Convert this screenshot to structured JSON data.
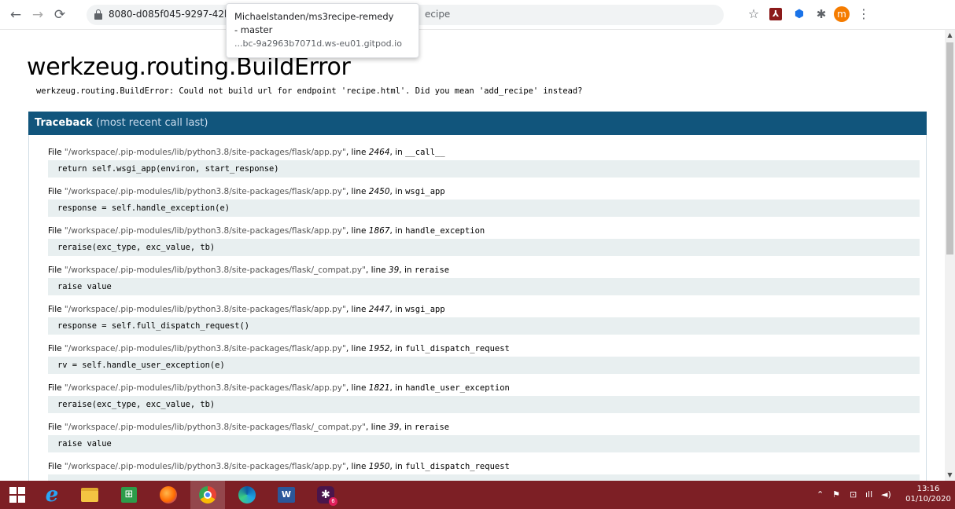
{
  "browser": {
    "url_visible_start": "8080-d085f045-9297-42bc-94b",
    "url_visible_end": "ecipe",
    "profile_initial": "m",
    "tooltip": {
      "title_line1": "Michaelstanden/ms3recipe-remedy",
      "title_line2": "- master",
      "url": "...bc-9a2963b7071d.ws-eu01.gitpod.io"
    },
    "icons": [
      "back-arrow-icon",
      "forward-arrow-icon",
      "reload-icon",
      "lock-icon",
      "star-icon",
      "acrobat-icon",
      "extension-icon",
      "puzzle-icon",
      "profile-avatar",
      "menu-dots-icon"
    ]
  },
  "page": {
    "title": "werkzeug.routing.BuildError",
    "error_message": "werkzeug.routing.BuildError: Could not build url for endpoint 'recipe.html'. Did you mean 'add_recipe' instead?",
    "traceback_header": "Traceback",
    "traceback_sub": "(most recent call last)",
    "frames": [
      {
        "file": "\"/workspace/.pip-modules/lib/python3.8/site-packages/flask/app.py\"",
        "line": "2464",
        "func": "__call__",
        "source": "return self.wsgi_app(environ, start_response)"
      },
      {
        "file": "\"/workspace/.pip-modules/lib/python3.8/site-packages/flask/app.py\"",
        "line": "2450",
        "func": "wsgi_app",
        "source": "response = self.handle_exception(e)"
      },
      {
        "file": "\"/workspace/.pip-modules/lib/python3.8/site-packages/flask/app.py\"",
        "line": "1867",
        "func": "handle_exception",
        "source": "reraise(exc_type, exc_value, tb)"
      },
      {
        "file": "\"/workspace/.pip-modules/lib/python3.8/site-packages/flask/_compat.py\"",
        "line": "39",
        "func": "reraise",
        "source": "raise value"
      },
      {
        "file": "\"/workspace/.pip-modules/lib/python3.8/site-packages/flask/app.py\"",
        "line": "2447",
        "func": "wsgi_app",
        "source": "response = self.full_dispatch_request()"
      },
      {
        "file": "\"/workspace/.pip-modules/lib/python3.8/site-packages/flask/app.py\"",
        "line": "1952",
        "func": "full_dispatch_request",
        "source": "rv = self.handle_user_exception(e)"
      },
      {
        "file": "\"/workspace/.pip-modules/lib/python3.8/site-packages/flask/app.py\"",
        "line": "1821",
        "func": "handle_user_exception",
        "source": "reraise(exc_type, exc_value, tb)"
      },
      {
        "file": "\"/workspace/.pip-modules/lib/python3.8/site-packages/flask/_compat.py\"",
        "line": "39",
        "func": "reraise",
        "source": "raise value"
      },
      {
        "file": "\"/workspace/.pip-modules/lib/python3.8/site-packages/flask/app.py\"",
        "line": "1950",
        "func": "full_dispatch_request",
        "source": ""
      }
    ],
    "labels": {
      "file": "File ",
      "line": ", line ",
      "in": ", in "
    }
  },
  "taskbar": {
    "time": "13:16",
    "date": "01/10/2020",
    "apps": [
      "windows-start-icon",
      "internet-explorer-icon",
      "file-explorer-icon",
      "store-icon",
      "firefox-icon",
      "chrome-icon",
      "edge-icon",
      "word-icon",
      "slack-icon"
    ],
    "slack_badge": "6",
    "word_label": "W"
  },
  "colors": {
    "traceback_header_bg": "#11557c",
    "source_bg": "#e8eff0",
    "taskbar_bg": "#7d1f25"
  }
}
